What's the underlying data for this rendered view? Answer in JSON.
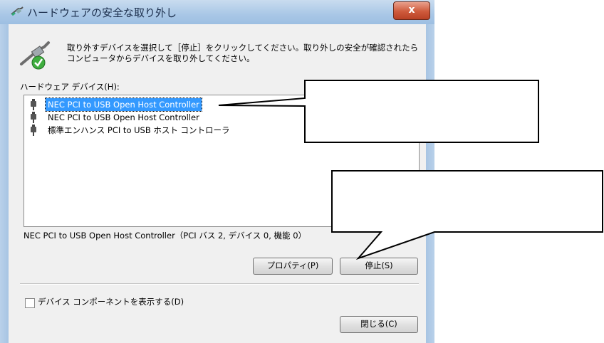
{
  "window": {
    "title": "ハードウェアの安全な取り外し",
    "close_label": "x"
  },
  "instruction": "取り外すデバイスを選択して［停止］をクリックしてください。取り外しの安全が確認されたらコンピュータからデバイスを取り外してください。",
  "hardware_label": "ハードウェア デバイス(H):",
  "devices": [
    {
      "label": "NEC PCI to USB Open Host Controller",
      "selected": true
    },
    {
      "label": "NEC PCI to USB Open Host Controller",
      "selected": false
    },
    {
      "label": "標準エンハンス PCI to USB ホスト コントローラ",
      "selected": false
    }
  ],
  "detail_text": "NEC PCI to USB Open Host Controller（PCI バス 2, デバイス 0, 機能 0）",
  "buttons": {
    "properties": "プロパティ(P)",
    "stop": "停止(S)",
    "close": "閉じる(C)"
  },
  "checkbox": {
    "label": "デバイス コンポーネントを表示する(D)",
    "checked": false
  },
  "colors": {
    "selection": "#3399ff",
    "frame": "#a9c7e6",
    "callout_fill": "#ffffff",
    "callout_stroke": "#000000"
  }
}
